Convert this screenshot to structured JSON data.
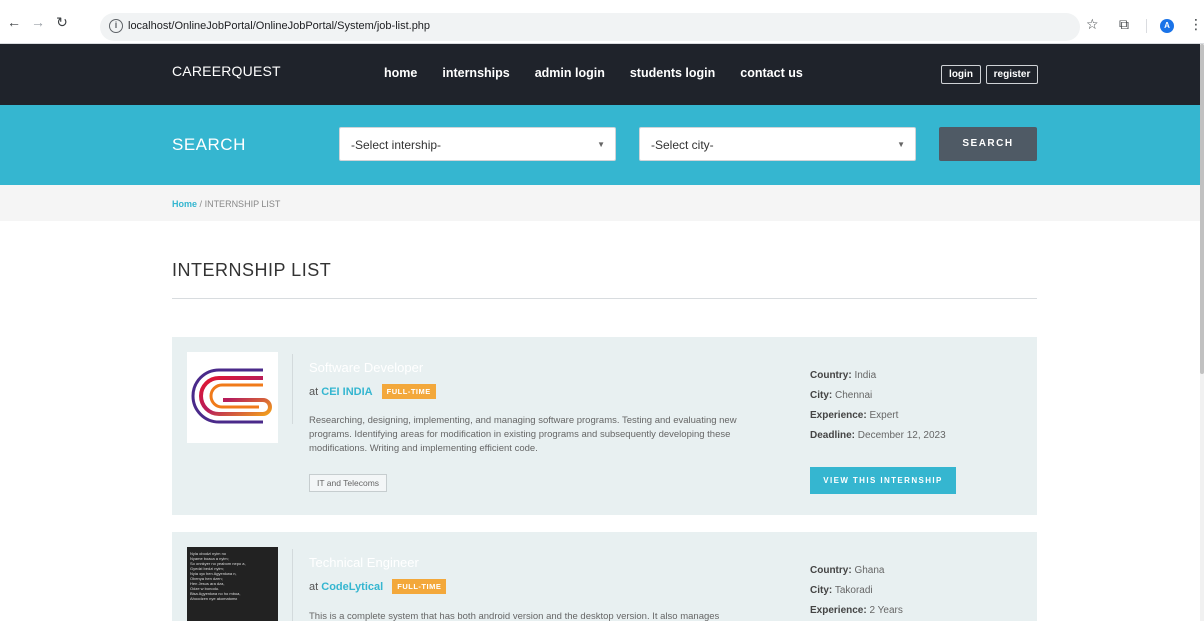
{
  "browser": {
    "url": "localhost/OnlineJobPortal/OnlineJobPortal/System/job-list.php",
    "profile_initial": "A"
  },
  "nav": {
    "brand": "CAREERQUEST",
    "links": [
      "home",
      "internships",
      "admin login",
      "students login",
      "contact us"
    ],
    "login_label": "login",
    "register_label": "register"
  },
  "search": {
    "label": "SEARCH",
    "internship_select": "-Select intership-",
    "city_select": "-Select city-",
    "button_label": "SEARCH"
  },
  "breadcrumb": {
    "home": "Home",
    "separator": "/",
    "current": "INTERNSHIP LIST"
  },
  "page_title": "INTERNSHIP LIST",
  "listings": [
    {
      "title": "Software Developer",
      "at": "at",
      "company": "CEI INDIA",
      "type": "FULL-TIME",
      "description": "Researching, designing, implementing, and managing software programs. Testing and evaluating new programs. Identifying areas for modification in existing programs and subsequently developing these modifications. Writing and implementing efficient code.",
      "tag": "IT and Telecoms",
      "country_label": "Country:",
      "country": "India",
      "city_label": "City:",
      "city": "Chennai",
      "experience_label": "Experience:",
      "experience": "Expert",
      "deadline_label": "Deadline:",
      "deadline": "December 12, 2023",
      "button_label": "VIEW THIS INTERNSHIP"
    },
    {
      "title": "Technical Engineer",
      "at": "at",
      "company": "CodeLytical",
      "type": "FULL-TIME",
      "description": "This is a complete system that has both android version and the desktop version. It also manages",
      "country_label": "Country:",
      "country": "Ghana",
      "city_label": "City:",
      "city": "Takoradi",
      "experience_label": "Experience:",
      "experience": "2 Years",
      "logo_text": "Nyla obodzi nyim no\nNyame boaca a nyim;\nSo onnkyer no yeabom nepo a,\nGyedzi bedzi nyim;\nNyia ɔyɛ hen Agyenkwa n,\nObenya hen dzen;\nHen Jesus ara dza,\nOdze w bonodu.\nBisa Agyenkwa no ho mboa,\nAhoodzen nye akomatomɛ"
    }
  ],
  "colors": {
    "nav_bg": "#1f232b",
    "accent": "#35b6d0",
    "badge": "#f3a83b",
    "search_button": "#4f5a65",
    "card_bg": "#e8f0f1"
  }
}
